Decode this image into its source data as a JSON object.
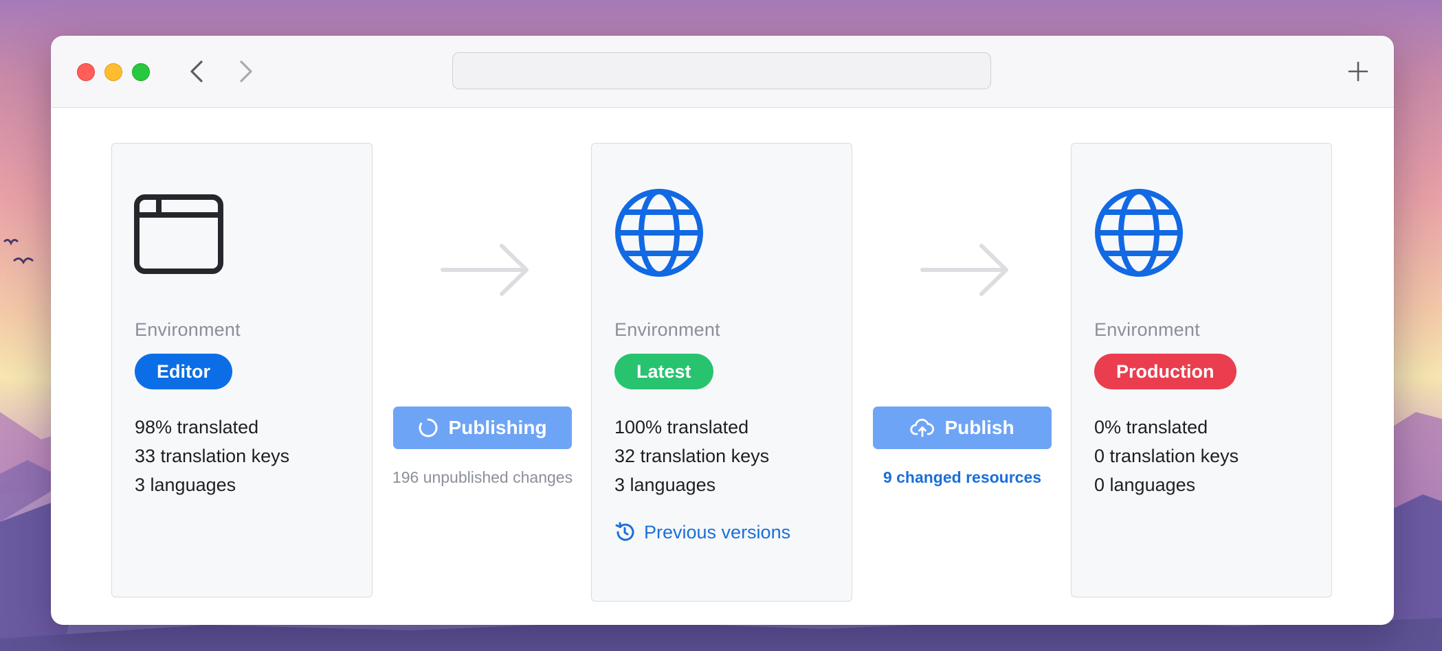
{
  "browser": {
    "url": ""
  },
  "flow": {
    "cards": [
      {
        "icon": "browser-window-icon",
        "env_label": "Environment",
        "badge": "Editor",
        "badge_color": "#0b6ee6",
        "stats": [
          "98% translated",
          "33 translation keys",
          "3 languages"
        ]
      },
      {
        "icon": "globe-icon",
        "env_label": "Environment",
        "badge": "Latest",
        "badge_color": "#28c36f",
        "stats": [
          "100% translated",
          "32 translation keys",
          "3 languages"
        ],
        "link": "Previous versions",
        "link_icon": "history-icon"
      },
      {
        "icon": "globe-icon",
        "env_label": "Environment",
        "badge": "Production",
        "badge_color": "#ea3e4f",
        "stats": [
          "0% translated",
          "0 translation keys",
          "0 languages"
        ]
      }
    ],
    "actions": [
      {
        "label": "Publishing",
        "icon": "spinner-icon",
        "note": "196 unpublished changes"
      },
      {
        "label": "Publish",
        "icon": "cloud-upload-icon",
        "note": "9 changed resources"
      }
    ]
  },
  "colors": {
    "accent": "#1a6fd8",
    "button": "#6ea4f5",
    "globe": "#1169e4"
  }
}
